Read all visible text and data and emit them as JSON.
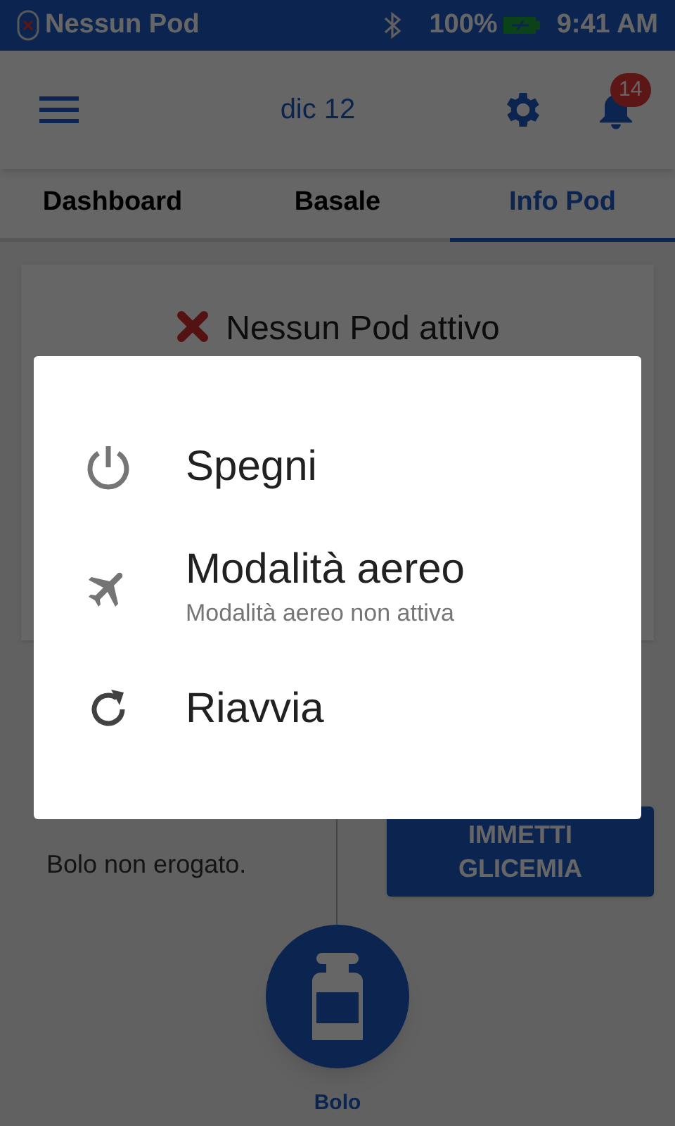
{
  "status_bar": {
    "pod_status": "Nessun Pod",
    "battery": "100%",
    "time": "9:41 AM"
  },
  "header": {
    "date": "dic 12",
    "notification_count": "14"
  },
  "tabs": [
    {
      "label": "Dashboard",
      "selected": false
    },
    {
      "label": "Basale",
      "selected": false
    },
    {
      "label": "Info Pod",
      "selected": true
    }
  ],
  "pod_card": {
    "message": "Nessun Pod attivo"
  },
  "bolus_status": "Bolo non erogato.",
  "glucose_button": "IMMETTI GLICEMIA",
  "bolus_button": {
    "label": "Bolo"
  },
  "power_menu": {
    "items": [
      {
        "kind": "power",
        "label": "Spegni"
      },
      {
        "kind": "airplane",
        "label": "Modalità aereo",
        "subtitle": "Modalità aereo non attiva"
      },
      {
        "kind": "restart",
        "label": "Riavvia"
      }
    ]
  }
}
